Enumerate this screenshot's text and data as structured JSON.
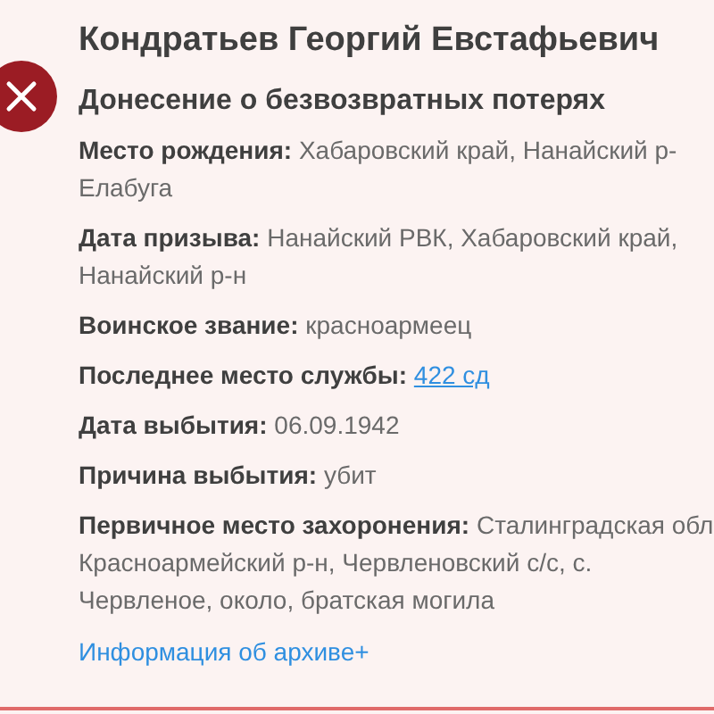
{
  "status": {
    "kind": "killed"
  },
  "name": "Кондратьев Георгий Евстафьевич",
  "document": "Донесение о безвозвратных потерях",
  "fields": [
    {
      "label": "Место рождения:",
      "lines": [
        "Хабаровский край, Нанайский р-",
        "Елабуга"
      ],
      "kind": "text"
    },
    {
      "label": "Дата призыва:",
      "lines": [
        "Нанайский РВК, Хабаровский край,",
        "Нанайский р-н"
      ],
      "kind": "text"
    },
    {
      "label": "Воинское звание:",
      "lines": [
        "красноармеец"
      ],
      "kind": "text"
    },
    {
      "label": "Последнее место службы:",
      "lines": [
        "422 сд"
      ],
      "kind": "link"
    },
    {
      "label": "Дата выбытия:",
      "lines": [
        "06.09.1942"
      ],
      "kind": "text"
    },
    {
      "label": "Причина выбытия:",
      "lines": [
        "убит"
      ],
      "kind": "text"
    },
    {
      "label": "Первичное место захоронения:",
      "lines": [
        "Сталинградская обл",
        "Красноармейский р-н, Червленовский с/с, с.",
        "Червленое, около, братская могила"
      ],
      "kind": "text"
    }
  ],
  "archive_link": "Информация об архиве+"
}
